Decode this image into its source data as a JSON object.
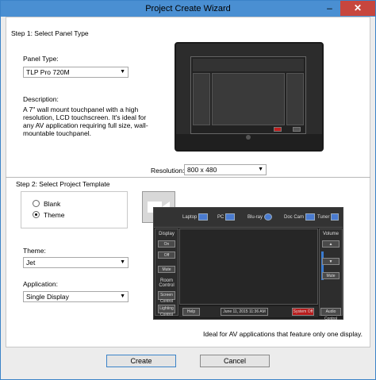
{
  "window": {
    "title": "Project Create Wizard",
    "minimize_label": "–",
    "close_label": "✕"
  },
  "step1": {
    "title": "Step 1: Select Panel Type",
    "panel_type_label": "Panel Type:",
    "panel_type_value": "TLP Pro 720M",
    "description_label": "Description:",
    "description_lines": [
      "A 7\" wall mount touchpanel with a high",
      "resolution, LCD touchscreen. It's ideal for",
      "any AV application requiring full size, wall-",
      "mountable touchpanel."
    ],
    "resolution_label": "Resolution:",
    "resolution_value": "800 x 480"
  },
  "step2": {
    "title": "Step 2: Select Project Template",
    "radio_blank": "Blank",
    "radio_theme": "Theme",
    "selected": "Theme",
    "theme_label": "Theme:",
    "theme_value": "Jet",
    "application_label": "Application:",
    "application_value": "Single Display",
    "ideal_text": "Ideal for AV applications that feature only one display."
  },
  "template_preview": {
    "tabs": [
      "Laptop",
      "PC",
      "Blu-ray",
      "Doc Cam",
      "Tuner"
    ],
    "left_title": "Display",
    "left_buttons": [
      "On",
      "Off",
      "Mute"
    ],
    "room_control": "Room Control",
    "screen_control": "Screen Control",
    "lighting_control": "Lighting Control",
    "right_title": "Volume",
    "right_buttons": [
      "Mute"
    ],
    "help": "Help",
    "date": "June 11, 2015 11:36 AM",
    "system_off": "System Off",
    "audio_control": "Audio Control"
  },
  "footer": {
    "create_label": "Create",
    "cancel_label": "Cancel"
  }
}
